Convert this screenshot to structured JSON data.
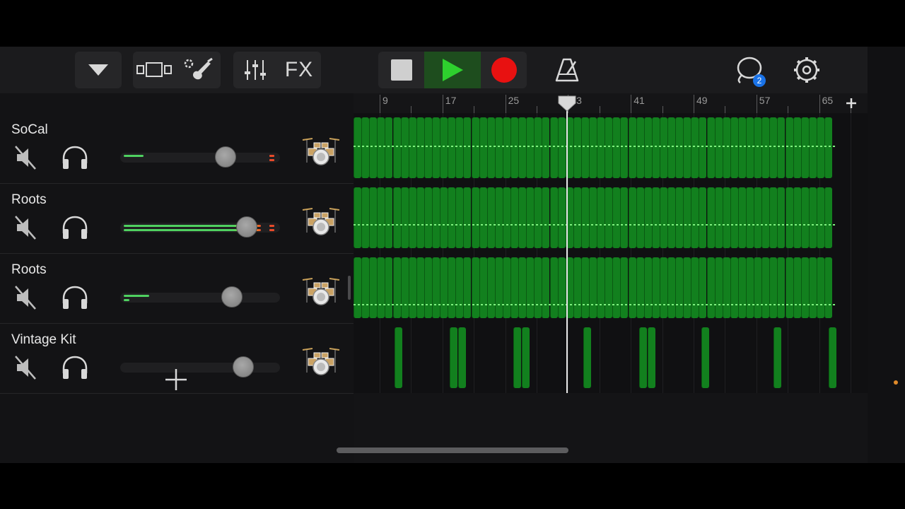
{
  "toolbar": {
    "fx_label": "FX",
    "notifications_count": "2"
  },
  "tracks": [
    {
      "name": "SoCal",
      "volume": 0.66,
      "meter_top": 0.14,
      "meter_bottom": 0,
      "clip": true,
      "icon": "drum-kit-icon"
    },
    {
      "name": "Roots",
      "volume": 0.79,
      "meter_top": 0.97,
      "meter_bottom": 0.97,
      "clip": true,
      "icon": "drum-kit-icon"
    },
    {
      "name": "Roots",
      "volume": 0.7,
      "meter_top": 0.18,
      "meter_bottom": 0.04,
      "clip": false,
      "icon": "drum-kit-icon"
    },
    {
      "name": "Vintage Kit",
      "volume": 0.77,
      "meter_top": 0,
      "meter_bottom": 0,
      "clip": false,
      "icon": "drum-kit-icon"
    }
  ],
  "ruler": {
    "bar_labels": [
      "9",
      "17",
      "25",
      "33",
      "41",
      "49",
      "57",
      "65"
    ]
  },
  "colors": {
    "region_green": "#12801e",
    "record_red": "#e81111",
    "play_green": "#2ed02e",
    "meter_green": "#4fd160"
  }
}
